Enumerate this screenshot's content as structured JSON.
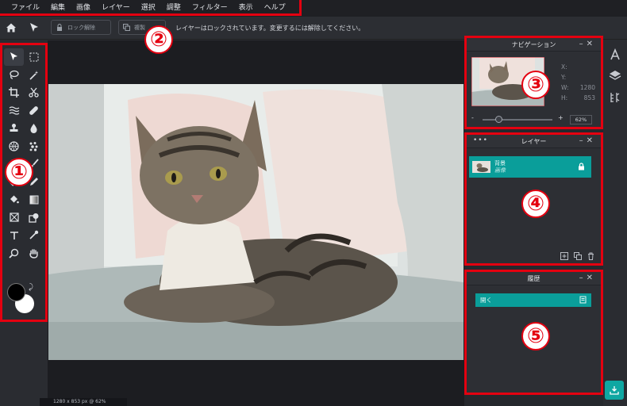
{
  "menu": {
    "items": [
      "ファイル",
      "編集",
      "画像",
      "レイヤー",
      "選択",
      "調整",
      "フィルター",
      "表示",
      "ヘルプ"
    ]
  },
  "optionbar": {
    "unlock_label": "ロック解除",
    "duplicate_label": "複製",
    "lock_message": "レイヤーはロックされています。変更するには解除してください。"
  },
  "navigator": {
    "title": "ナビゲーション",
    "x_label": "X:",
    "y_label": "Y:",
    "w_label": "W:",
    "h_label": "H:",
    "width_value": "1280",
    "height_value": "853",
    "zoom_minus": "-",
    "zoom_plus": "+",
    "zoom_value": "62%",
    "zoom_fraction": 0.62
  },
  "layers": {
    "title": "レイヤー",
    "items": [
      {
        "name": "背景",
        "type": "画像",
        "locked": true
      }
    ]
  },
  "history": {
    "title": "履歴",
    "items": [
      "開く"
    ]
  },
  "status": {
    "text": "1280 x 853 px @ 62%"
  },
  "markers": [
    "①",
    "②",
    "③",
    "④",
    "⑤"
  ],
  "colors": {
    "accent": "#0a9e9a",
    "highlight_border": "#e40010",
    "foreground": "#000000",
    "background": "#ffffff"
  },
  "icons": {
    "tools": [
      "pointer-icon",
      "marquee-icon",
      "lasso-icon",
      "magic-wand-icon",
      "crop-icon",
      "cut-icon",
      "liquify-icon",
      "healing-icon",
      "stamp-icon",
      "blur-drop-icon",
      "sponge-icon",
      "dodge-icon",
      "circle-shape-icon",
      "brush-icon",
      "eraser-icon",
      "pencil-icon",
      "bucket-icon",
      "gradient-icon",
      "frame-icon",
      "shape-icon",
      "text-icon",
      "eyedropper-icon",
      "zoom-icon",
      "hand-icon"
    ]
  }
}
